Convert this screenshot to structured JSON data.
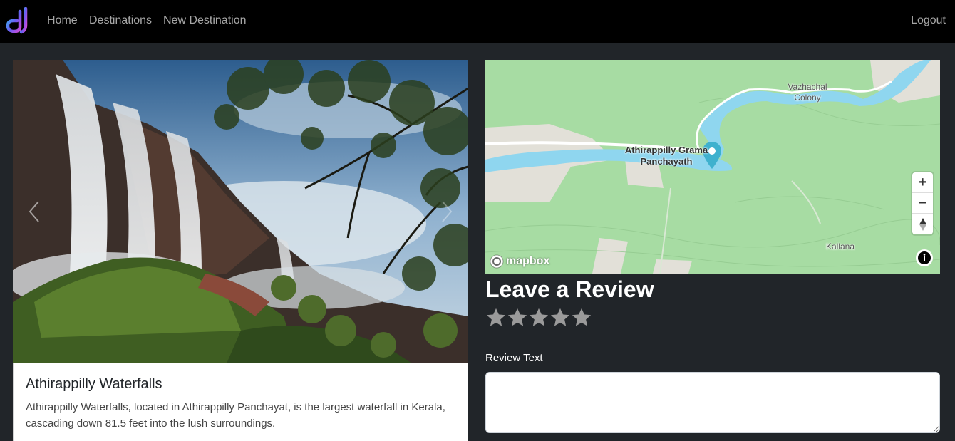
{
  "navbar": {
    "home": "Home",
    "destinations": "Destinations",
    "new_destination": "New Destination",
    "logout": "Logout"
  },
  "destination": {
    "title": "Athirappilly Waterfalls",
    "description": "Athirappilly Waterfalls, located in Athirappilly Panchayat, is the largest waterfall in Kerala, cascading down 81.5 feet into the lush surroundings."
  },
  "map": {
    "marker_label": "Athirappilly Grama Panchayath",
    "place_1": "Vazhachal Colony",
    "place_2": "Kallana",
    "attribution_logo": "mapbox",
    "zoom_in": "+",
    "zoom_out": "−"
  },
  "review": {
    "heading": "Leave a Review",
    "star_count": 5,
    "rating": 0,
    "text_label": "Review Text",
    "text_value": ""
  },
  "colors": {
    "navbar_bg": "#000000",
    "page_bg": "#212529",
    "map_land": "#a7dca3",
    "map_water": "#8fd6ef",
    "marker": "#3fb1ce",
    "star_empty": "#9a9a9a"
  }
}
